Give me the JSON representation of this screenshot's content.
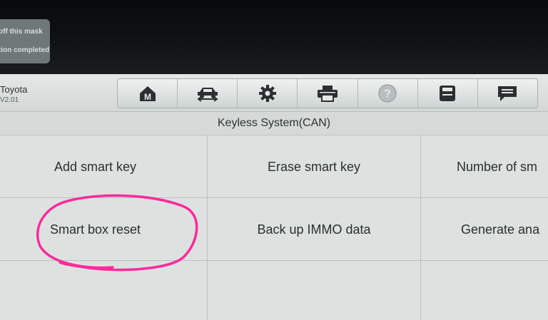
{
  "notification": {
    "line1": "off this mask",
    "line2": "tion completed"
  },
  "vehicle": {
    "make": "Toyota",
    "version": "V2.01"
  },
  "toolbar": {
    "buttons": [
      {
        "icon": "home-icon"
      },
      {
        "icon": "vehicle-swap-icon"
      },
      {
        "icon": "gear-icon"
      },
      {
        "icon": "printer-icon"
      },
      {
        "icon": "help-icon",
        "state": "disabled"
      },
      {
        "icon": "save-icon"
      },
      {
        "icon": "message-icon"
      }
    ]
  },
  "page": {
    "title": "Keyless System(CAN)"
  },
  "functions": [
    {
      "label": "Add smart key"
    },
    {
      "label": "Erase smart key"
    },
    {
      "label": "Number of sm"
    },
    {
      "label": "Smart box reset"
    },
    {
      "label": "Back up IMMO data"
    },
    {
      "label": "Generate ana"
    }
  ],
  "annotation": {
    "color": "#ff2a9c"
  }
}
